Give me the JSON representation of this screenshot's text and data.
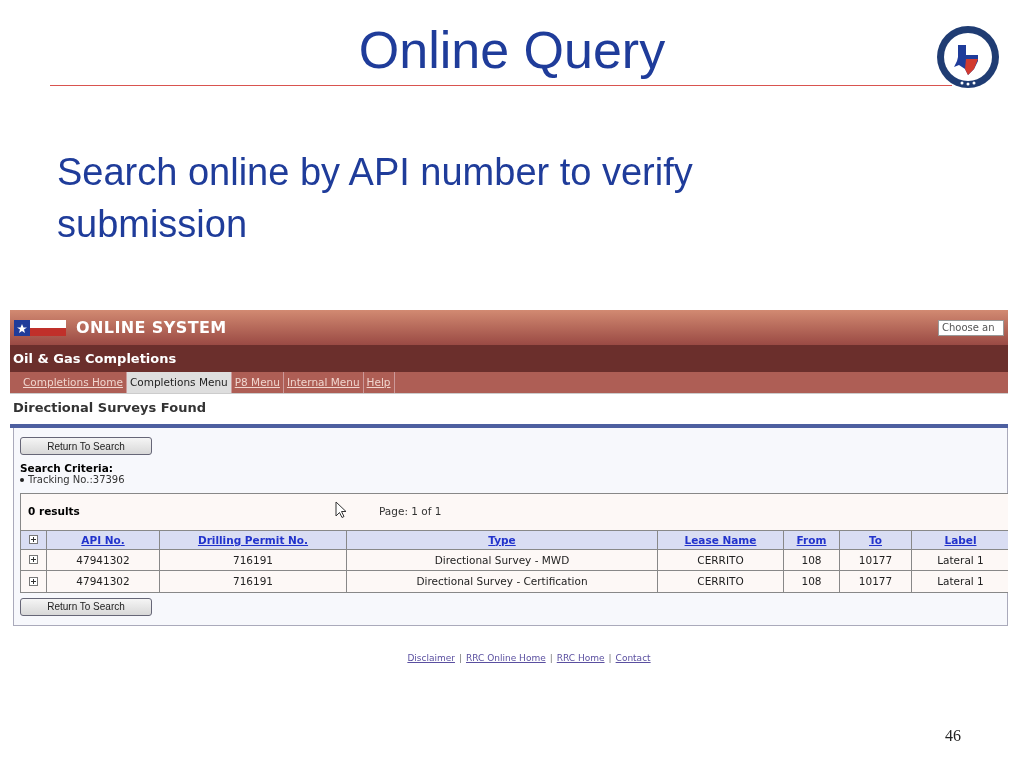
{
  "slide": {
    "title": "Online Query",
    "subtitle": "Search online by API number to verify submission",
    "page_number": "46"
  },
  "app": {
    "system_title": "ONLINE SYSTEM",
    "select_value": "Choose an",
    "section_title": "Oil & Gas Completions",
    "tabs": [
      {
        "label": "Completions Home",
        "selected": false
      },
      {
        "label": "Completions Menu",
        "selected": true
      },
      {
        "label": "P8 Menu",
        "selected": false
      },
      {
        "label": "Internal Menu",
        "selected": false
      },
      {
        "label": "Help",
        "selected": false
      }
    ],
    "heading": "Directional Surveys Found",
    "return_button": "Return To Search",
    "criteria_label": "Search Criteria:",
    "criteria": [
      "Tracking No.:37396"
    ],
    "results_count": "0 results",
    "page_info": "Page: 1 of 1",
    "table": {
      "columns": [
        "API No.",
        "Drilling Permit No.",
        "Type",
        "Lease Name",
        "From",
        "To",
        "Label"
      ],
      "rows": [
        [
          "47941302",
          "716191",
          "Directional Survey - MWD",
          "CERRITO",
          "108",
          "10177",
          "Lateral 1"
        ],
        [
          "47941302",
          "716191",
          "Directional Survey - Certification",
          "CERRITO",
          "108",
          "10177",
          "Lateral 1"
        ]
      ]
    },
    "return_button_bottom": "Return To Search",
    "footer_links": [
      "Disclaimer",
      "RRC Online Home",
      "RRC Home",
      "Contact"
    ],
    "footer_separators": [
      "|",
      "|",
      "|"
    ]
  }
}
